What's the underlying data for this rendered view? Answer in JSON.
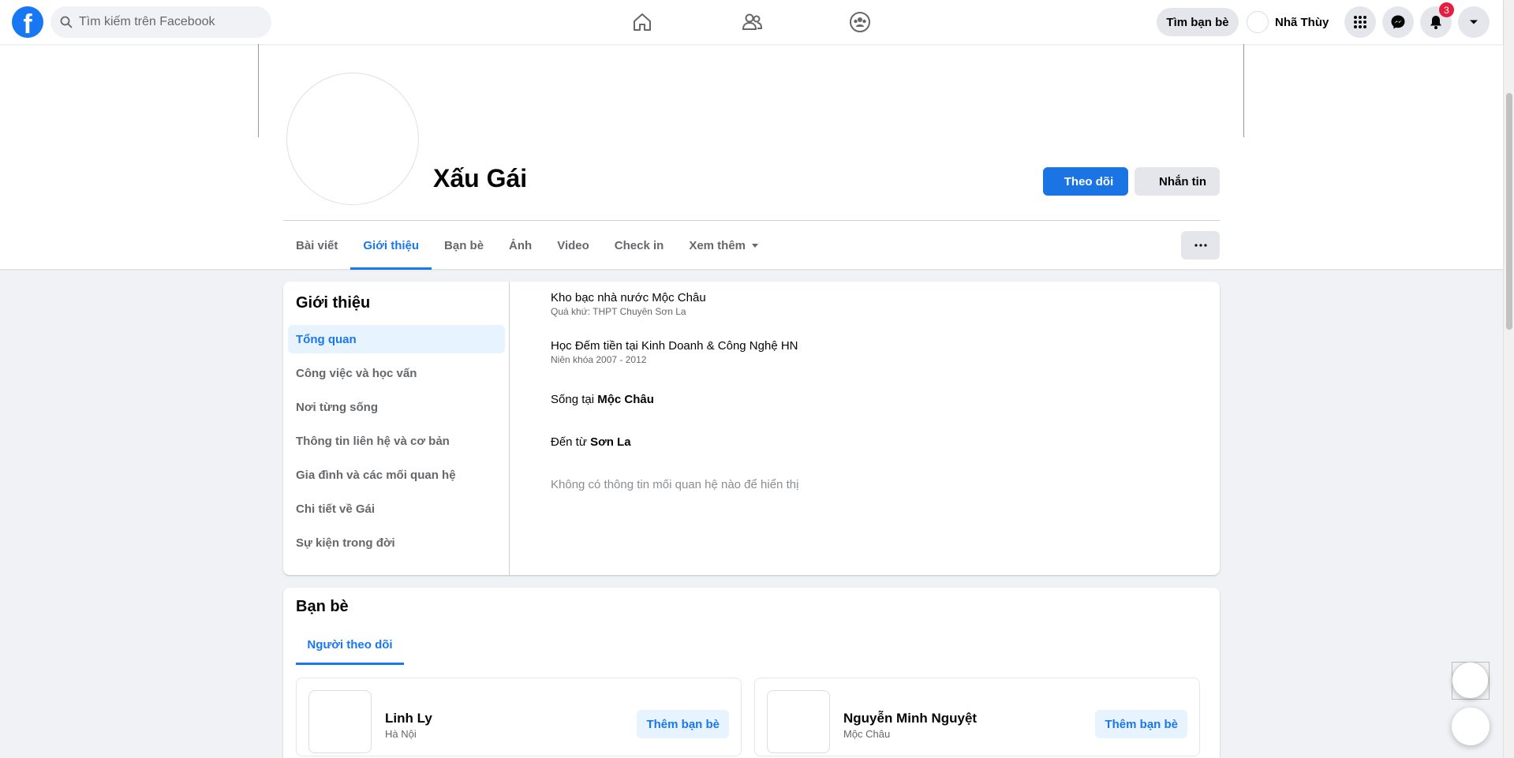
{
  "nav": {
    "logo_letter": "f",
    "search_placeholder": "Tìm kiếm trên Facebook",
    "find_friends": "Tìm bạn bè",
    "user_name": "Nhã Thùy",
    "notification_count": "3"
  },
  "profile": {
    "name": "Xấu Gái",
    "follow_label": "Theo dõi",
    "message_label": "Nhắn tin",
    "tabs": [
      "Bài viết",
      "Giới thiệu",
      "Bạn bè",
      "Ảnh",
      "Video",
      "Check in",
      "Xem thêm"
    ],
    "active_tab": "Giới thiệu",
    "more_label": "···"
  },
  "about": {
    "title": "Giới thiệu",
    "nav_items": [
      "Tổng quan",
      "Công việc và học vấn",
      "Nơi từng sống",
      "Thông tin liên hệ và cơ bản",
      "Gia đình và các mối quan hệ",
      "Chi tiết về Gái",
      "Sự kiện trong đời"
    ],
    "work_main": "Kho bạc nhà nước Mộc Châu",
    "work_sub": "Quá khứ: THPT Chuyên Sơn La",
    "edu_main": "Học Đếm tiền tại Kinh Doanh & Công Nghệ HN",
    "edu_sub": "Niên khóa 2007 - 2012",
    "lives_prefix": "Sống tại ",
    "lives_place": "Mộc Châu",
    "from_prefix": "Đến từ ",
    "from_place": "Sơn La",
    "relationship": "Không có thông tin mối quan hệ nào để hiển thị"
  },
  "friends": {
    "title": "Bạn bè",
    "tab": "Người theo dõi",
    "list": [
      {
        "name": "Linh Ly",
        "location": "Hà Nội",
        "action": "Thêm bạn bè"
      },
      {
        "name": "Nguyễn Minh Nguyệt",
        "location": "Mộc Châu",
        "action": "Thêm bạn bè"
      }
    ]
  },
  "colors": {
    "brand": "#1877f2",
    "background": "#f0f2f5",
    "badge": "#e41e3f"
  }
}
